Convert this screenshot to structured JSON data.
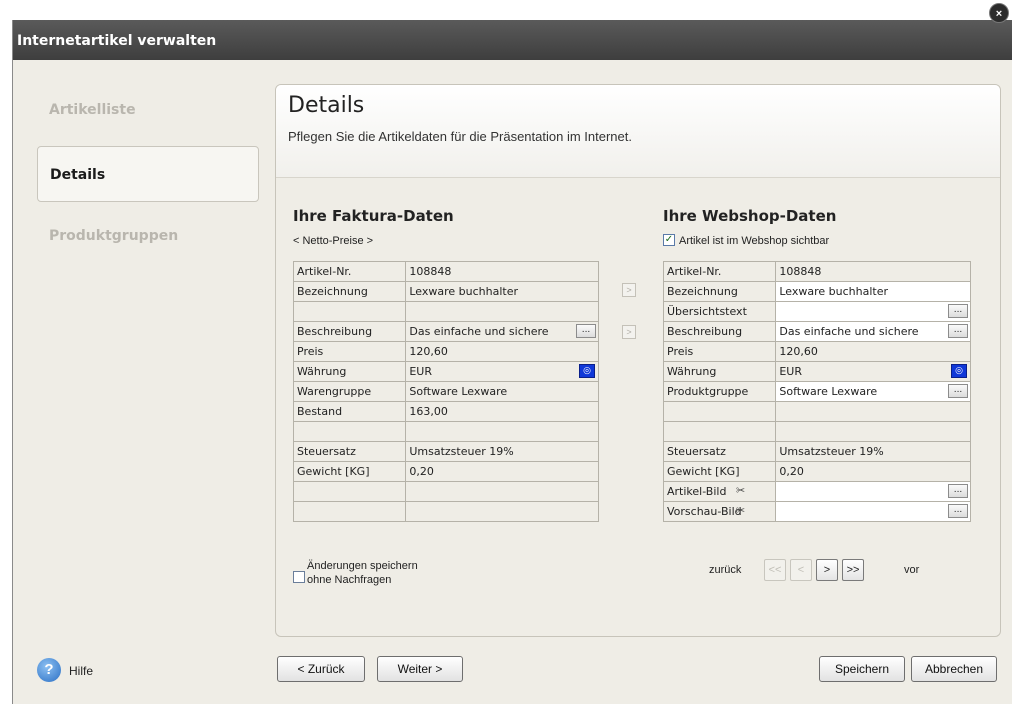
{
  "window": {
    "title": "Internetartikel verwalten",
    "close_label": "×"
  },
  "sidebar": {
    "items": [
      {
        "label": "Artikelliste"
      },
      {
        "label": "Details"
      },
      {
        "label": "Produktgruppen"
      }
    ]
  },
  "header": {
    "title": "Details",
    "subtitle": "Pflegen Sie die Artikeldaten für die Präsentation im Internet."
  },
  "faktura": {
    "title": "Ihre Faktura-Daten",
    "note": "< Netto-Preise >",
    "rows": [
      {
        "label": "Artikel-Nr.",
        "value": "108848"
      },
      {
        "label": "Bezeichnung",
        "value": "Lexware buchhalter"
      },
      {
        "label": "",
        "value": ""
      },
      {
        "label": "Beschreibung",
        "value": "Das einfache und sichere",
        "button": "..."
      },
      {
        "label": "Preis",
        "value": "120,60"
      },
      {
        "label": "Währung",
        "value": "EUR",
        "icon": "globe-icon"
      },
      {
        "label": "Warengruppe",
        "value": "Software Lexware"
      },
      {
        "label": "Bestand",
        "value": "163,00"
      },
      {
        "label": "",
        "value": ""
      },
      {
        "label": "Steuersatz",
        "value": "Umsatzsteuer 19%"
      },
      {
        "label": "Gewicht [KG]",
        "value": "0,20"
      },
      {
        "label": "",
        "value": ""
      },
      {
        "label": "",
        "value": ""
      }
    ]
  },
  "copy_arrows": [
    ">",
    ">"
  ],
  "webshop": {
    "title": "Ihre Webshop-Daten",
    "visible_label": "Artikel ist im Webshop sichtbar",
    "visible_checked": true,
    "rows": [
      {
        "label": "Artikel-Nr.",
        "value": "108848"
      },
      {
        "label": "Bezeichnung",
        "value": "Lexware buchhalter"
      },
      {
        "label": "Übersichtstext",
        "value": "",
        "button": "..."
      },
      {
        "label": "Beschreibung",
        "value": "Das einfache und sichere",
        "button": "..."
      },
      {
        "label": "Preis",
        "value": "120,60"
      },
      {
        "label": "Währung",
        "value": "EUR",
        "icon": "globe-icon"
      },
      {
        "label": "Produktgruppe",
        "value": "Software Lexware",
        "button": "..."
      },
      {
        "label": "",
        "value": ""
      },
      {
        "label": "",
        "value": ""
      },
      {
        "label": "Steuersatz",
        "value": "Umsatzsteuer 19%"
      },
      {
        "label": "Gewicht [KG]",
        "value": "0,20"
      },
      {
        "label": "Artikel-Bild",
        "value": "",
        "button": "...",
        "icon": "image-remove-icon"
      },
      {
        "label": "Vorschau-Bild",
        "value": "",
        "button": "...",
        "icon": "image-remove-icon"
      }
    ]
  },
  "save_option": {
    "line1": "Änderungen speichern",
    "line2": "ohne Nachfragen",
    "checked": false
  },
  "record_nav": {
    "back_label": "zurück",
    "forward_label": "vor",
    "first": "<<",
    "prev": "<",
    "next": ">",
    "last": ">>"
  },
  "footer": {
    "help": "Hilfe",
    "back": "< Zurück",
    "next": "Weiter >",
    "save": "Speichern",
    "cancel": "Abbrechen"
  }
}
